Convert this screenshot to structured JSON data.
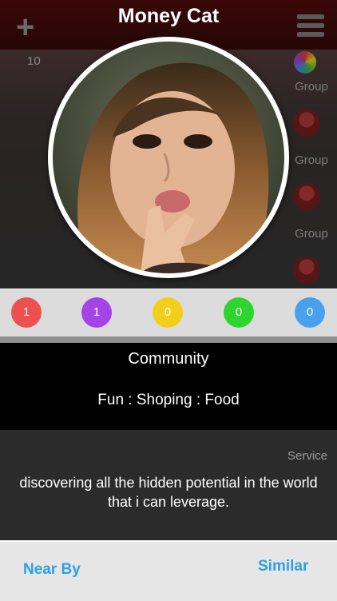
{
  "header": {
    "title": "Money Cat",
    "add_icon": "plus-icon",
    "menu_icon": "hamburger-icon"
  },
  "background": {
    "count": "10",
    "groups": [
      "Group",
      "Group",
      "Group"
    ],
    "service": "Service"
  },
  "profile": {
    "photo": "woman-peace-sign-photo"
  },
  "counts": [
    {
      "value": "1",
      "color": "#ee5050"
    },
    {
      "value": "1",
      "color": "#a444e6"
    },
    {
      "value": "0",
      "color": "#f2cf1a"
    },
    {
      "value": "0",
      "color": "#2fd52f"
    },
    {
      "value": "0",
      "color": "#4aa0ec"
    }
  ],
  "community": {
    "title": "Community",
    "tags": "Fun : Shoping : Food"
  },
  "description": "discovering all the hidden potential in the world that i can leverage.",
  "footer": {
    "near_by": "Near By",
    "similar": "Similar"
  },
  "colors": {
    "link": "#2e9fe6"
  }
}
